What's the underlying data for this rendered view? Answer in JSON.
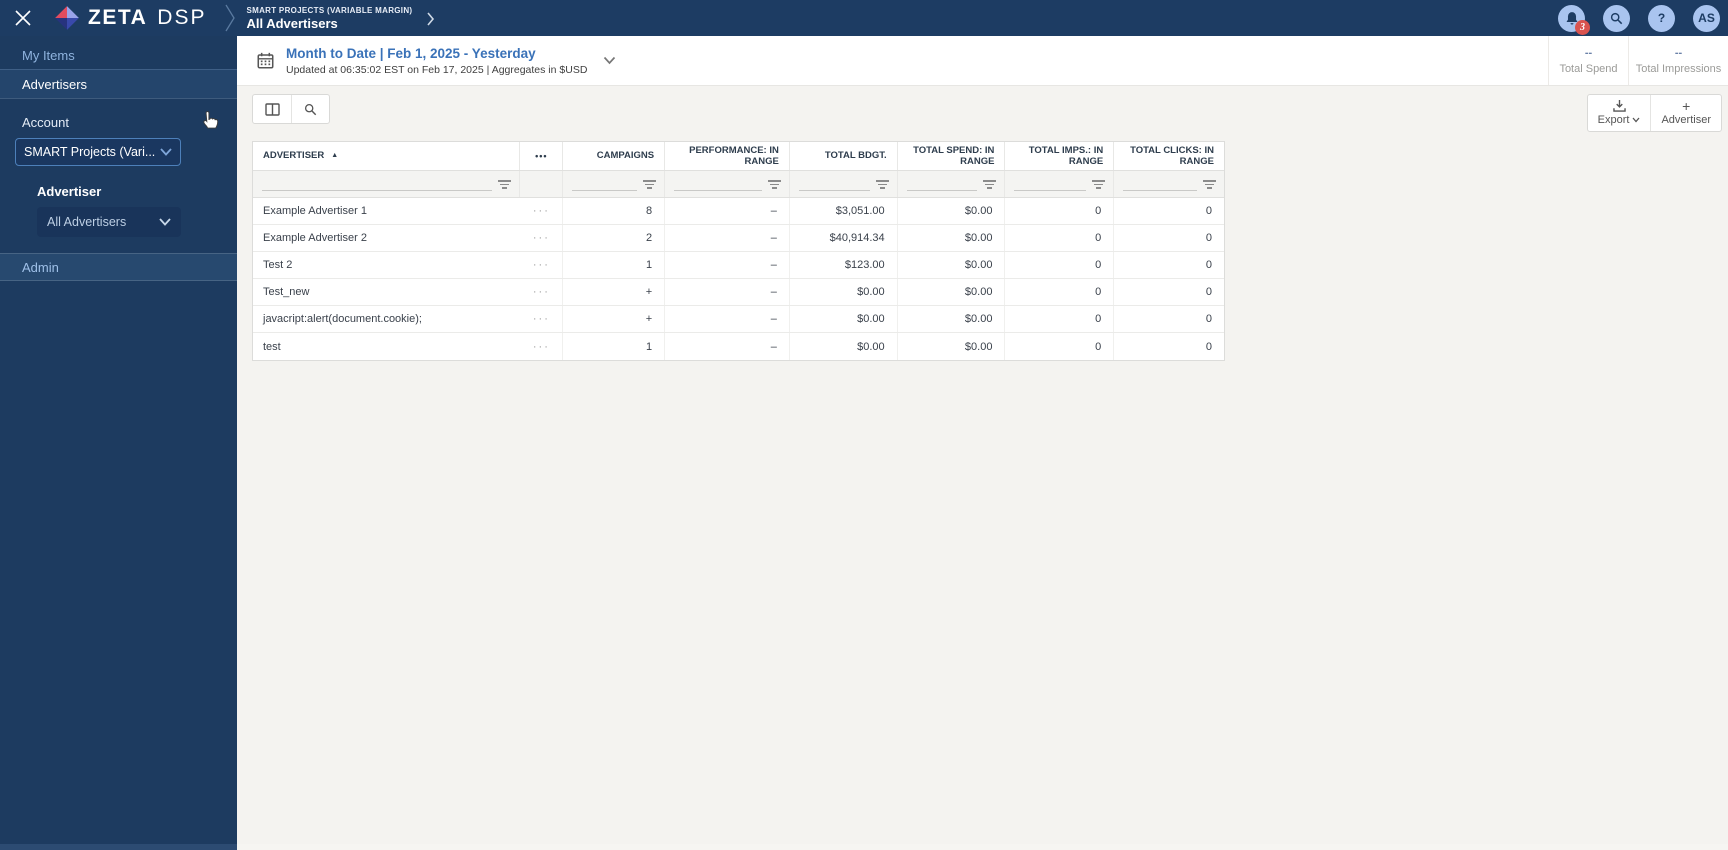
{
  "colors": {
    "topbar_navy": "#1d3c63",
    "sidebar_navy": "#1d3b60",
    "icon_circle": "#a9c4ef",
    "badge_red": "#d9534f",
    "link_blue": "#3a72b8",
    "content_bg": "#f4f3f0"
  },
  "topbar": {
    "brand": "ZETA",
    "brand_suffix": "DSP",
    "breadcrumb": {
      "account": "SMART PROJECTS (VARIABLE MARGIN)",
      "page": "All Advertisers"
    },
    "notifications_badge": "3",
    "help_glyph": "?",
    "avatar_initials": "AS"
  },
  "sidebar": {
    "my_items": "My Items",
    "advertisers": "Advertisers",
    "account_label": "Account",
    "account_value": "SMART Projects (Vari...",
    "advertiser_label": "Advertiser",
    "advertiser_value": "All Advertisers",
    "admin": "Admin"
  },
  "date_header": {
    "title": "Month to Date | Feb 1, 2025 - Yesterday",
    "subtitle": "Updated at 06:35:02 EST on Feb 17, 2025 | Aggregates in $USD",
    "metrics": [
      {
        "value": "--",
        "label": "Total Spend"
      },
      {
        "value": "--",
        "label": "Total Impressions"
      }
    ]
  },
  "toolbar": {
    "export_label": "Export",
    "add_advertiser_label": "Advertiser"
  },
  "icons": {
    "close": "x-lines",
    "zeta-logo": "diamond",
    "notifications": "bell",
    "global-search": "magnifier",
    "help": "question-mark",
    "calendar": "calendar-grid",
    "chevron-down": "v",
    "columns-view": "table-outline",
    "table-search": "magnifier",
    "export": "download-arrow",
    "add": "plus",
    "sort-asc": "▲",
    "column-filter": "filter-lines",
    "row-menu": "···"
  },
  "table": {
    "columns": [
      {
        "label": "ADVERTISER",
        "align": "left",
        "sorted": "asc"
      },
      {
        "label": "•••",
        "align": "center"
      },
      {
        "label": "CAMPAIGNS",
        "align": "right"
      },
      {
        "label": "PERFORMANCE: IN RANGE",
        "align": "right"
      },
      {
        "label": "TOTAL BDGT.",
        "align": "right"
      },
      {
        "label": "TOTAL SPEND: IN RANGE",
        "align": "right"
      },
      {
        "label": "TOTAL IMPS.: IN RANGE",
        "align": "right"
      },
      {
        "label": "TOTAL CLICKS: IN RANGE",
        "align": "right"
      }
    ],
    "row_menu_glyph": "···",
    "rows": [
      {
        "advertiser": "Example Advertiser 1",
        "campaigns": "8",
        "performance": "–",
        "total_budget": "$3,051.00",
        "total_spend": "$0.00",
        "total_impressions": "0",
        "total_clicks": "0"
      },
      {
        "advertiser": "Example Advertiser 2",
        "campaigns": "2",
        "performance": "–",
        "total_budget": "$40,914.34",
        "total_spend": "$0.00",
        "total_impressions": "0",
        "total_clicks": "0"
      },
      {
        "advertiser": "Test 2",
        "campaigns": "1",
        "performance": "–",
        "total_budget": "$123.00",
        "total_spend": "$0.00",
        "total_impressions": "0",
        "total_clicks": "0"
      },
      {
        "advertiser": "Test_new",
        "campaigns": "+",
        "performance": "–",
        "total_budget": "$0.00",
        "total_spend": "$0.00",
        "total_impressions": "0",
        "total_clicks": "0"
      },
      {
        "advertiser": "javacript:alert(document.cookie);",
        "campaigns": "+",
        "performance": "–",
        "total_budget": "$0.00",
        "total_spend": "$0.00",
        "total_impressions": "0",
        "total_clicks": "0"
      },
      {
        "advertiser": "test",
        "campaigns": "1",
        "performance": "–",
        "total_budget": "$0.00",
        "total_spend": "$0.00",
        "total_impressions": "0",
        "total_clicks": "0"
      }
    ]
  }
}
